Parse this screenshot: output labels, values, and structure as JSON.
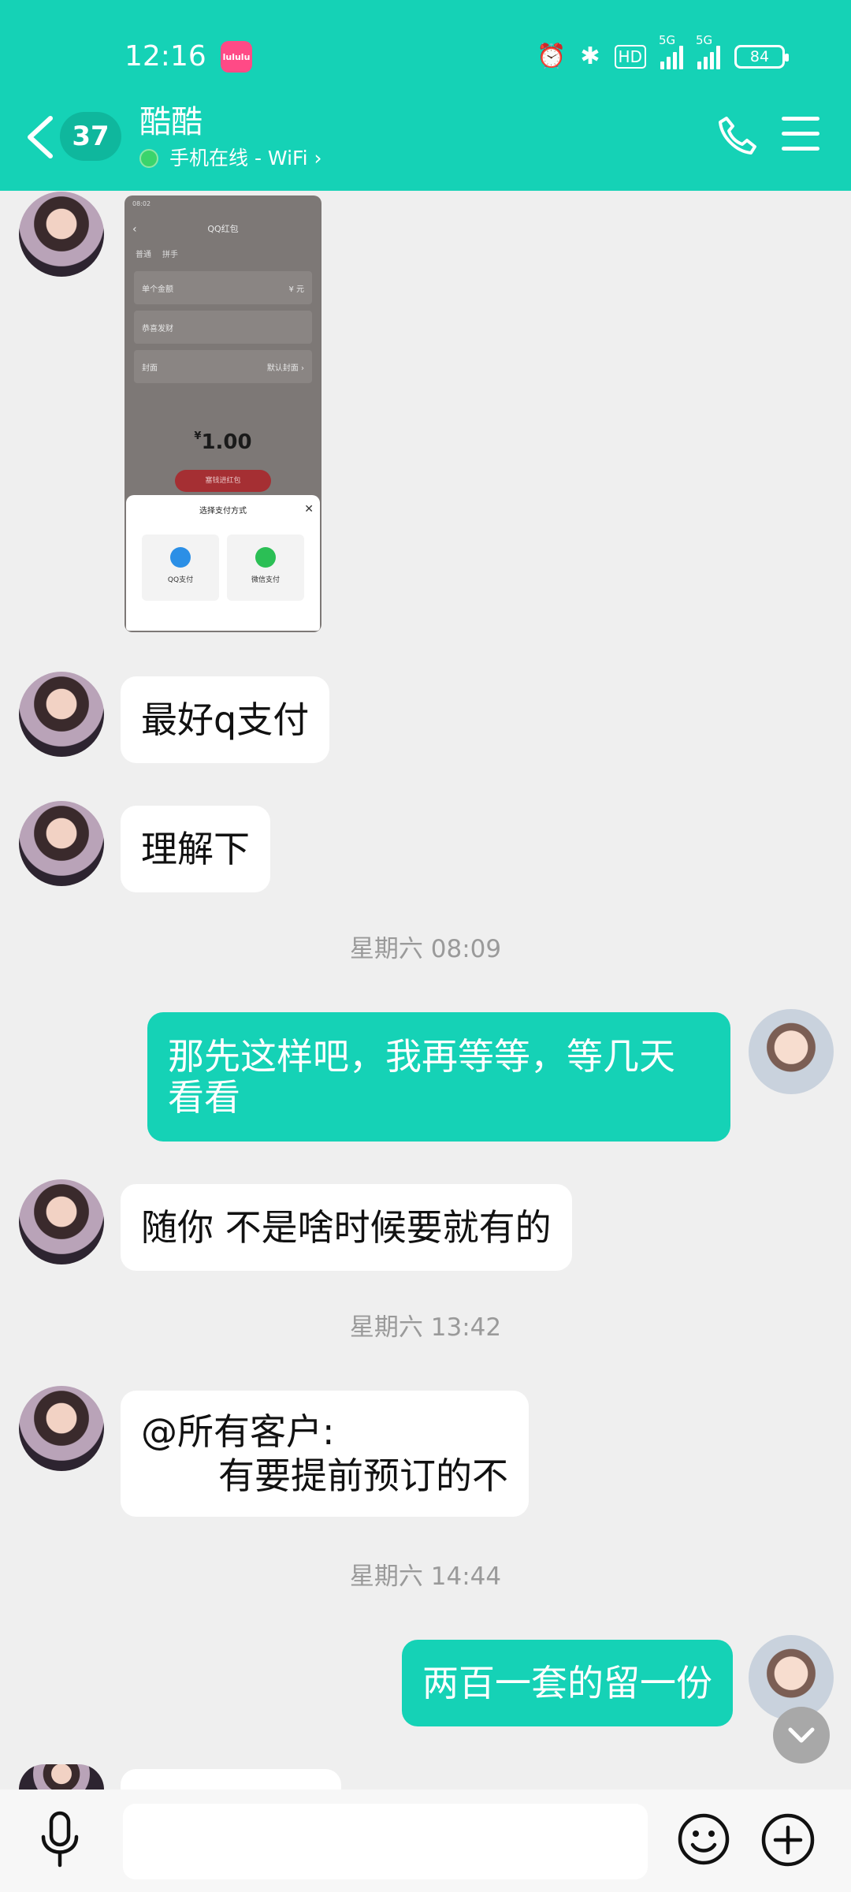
{
  "status_bar": {
    "time": "12:16",
    "app_badge": "lululu",
    "hd_label": "HD",
    "sig1_label": "5G",
    "sig2_label": "5G",
    "battery": "84"
  },
  "header": {
    "unread_count": "37",
    "title": "酷酷",
    "online_status": "手机在线 - WiFi ›"
  },
  "image_message": {
    "status_time": "08:02",
    "title": "QQ红包",
    "tabs": [
      "普通",
      "拼手"
    ],
    "rows": [
      {
        "label": "单个金额",
        "value": "¥ 元"
      },
      {
        "label": "恭喜发财",
        "value": ""
      },
      {
        "label": "封面",
        "value": "默认封面 ›"
      }
    ],
    "amount_symbol": "¥",
    "amount": "1.00",
    "red_button": "塞钱进红包",
    "sheet_title": "选择支付方式",
    "option_qq": "QQ支付",
    "option_wechat": "微信支付"
  },
  "messages": {
    "m1": "最好q支付",
    "m2": "理解下",
    "time1": "星期六 08:09",
    "m3": "那先这样吧，我再等等，等几天看看",
    "m4": "随你 不是啥时候要就有的",
    "time2": "星期六 13:42",
    "m5_line1": "@所有客户:",
    "m5_line2": "有要提前预订的不",
    "time3": "星期六 14:44",
    "m6": "两百一套的留一份"
  },
  "input": {
    "placeholder": ""
  },
  "colors": {
    "accent": "#15d2b6",
    "background": "#efefef"
  }
}
